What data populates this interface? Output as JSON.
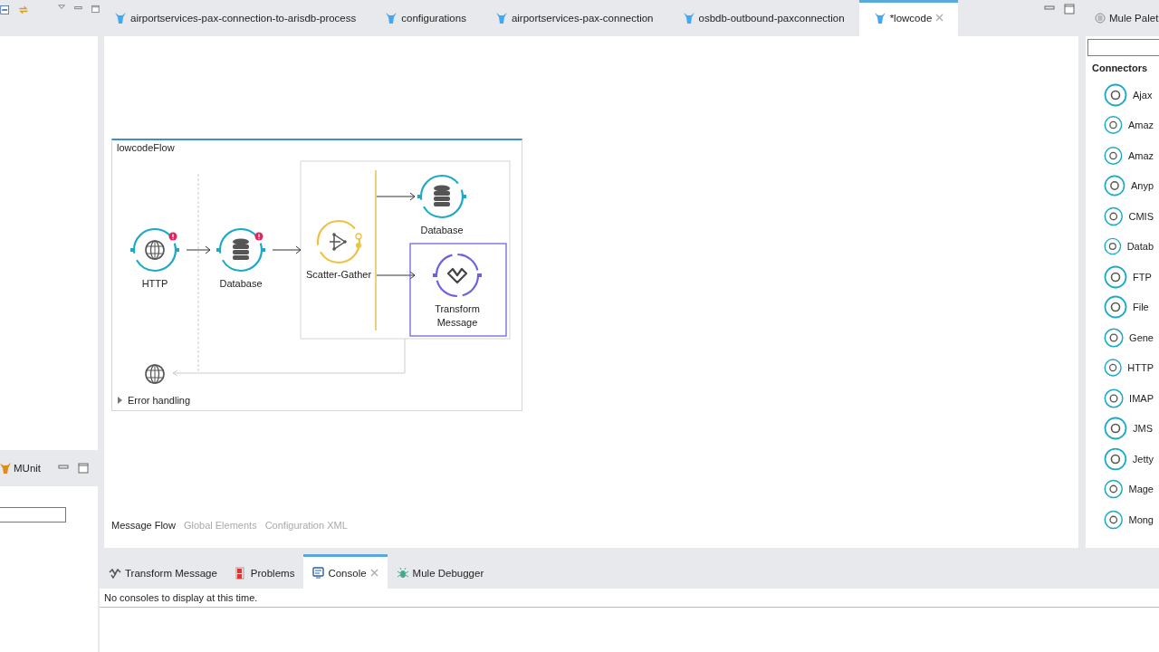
{
  "editor_tabs": [
    {
      "label": "airportservices-pax-connection-to-arisdb-process",
      "selected": false,
      "closable": false
    },
    {
      "label": "configurations",
      "selected": false,
      "closable": false
    },
    {
      "label": "airportservices-pax-connection",
      "selected": false,
      "closable": false
    },
    {
      "label": "osbdb-outbound-paxconnection",
      "selected": false,
      "closable": false
    },
    {
      "label": "*lowcode",
      "selected": true,
      "closable": true
    }
  ],
  "flow": {
    "title": "lowcodeFlow",
    "nodes": [
      {
        "kind": "http",
        "label": "HTTP",
        "error": true,
        "selected": false
      },
      {
        "kind": "database",
        "label": "Database",
        "error": true,
        "selected": false
      },
      {
        "kind": "scatter",
        "label": "Scatter-Gather",
        "error": false,
        "selected": false
      },
      {
        "kind": "database",
        "label": "Database",
        "error": false,
        "selected": false
      },
      {
        "kind": "transform",
        "label": "Transform Message",
        "error": false,
        "selected": true
      }
    ],
    "error_handling": {
      "label": "Error handling",
      "expanded": false
    }
  },
  "view_tabs": [
    {
      "label": "Message Flow",
      "selected": true
    },
    {
      "label": "Global Elements",
      "selected": false
    },
    {
      "label": "Configuration XML",
      "selected": false
    }
  ],
  "left_panel": {
    "title": "MUnit"
  },
  "palette": {
    "title": "Mule Palet",
    "section": "Connectors",
    "items": [
      {
        "label": "Ajax"
      },
      {
        "label": "Amaz"
      },
      {
        "label": "Amaz"
      },
      {
        "label": "Anyp"
      },
      {
        "label": "CMIS"
      },
      {
        "label": "Datab"
      },
      {
        "label": "FTP"
      },
      {
        "label": "File"
      },
      {
        "label": "Gene"
      },
      {
        "label": "HTTP"
      },
      {
        "label": "IMAP"
      },
      {
        "label": "JMS"
      },
      {
        "label": "Jetty"
      },
      {
        "label": "Mage"
      },
      {
        "label": "Mong"
      }
    ]
  },
  "bottom_tabs": [
    {
      "kind": "transform",
      "label": "Transform Message",
      "selected": false,
      "closable": false
    },
    {
      "kind": "problems",
      "label": "Problems",
      "selected": false,
      "closable": false
    },
    {
      "kind": "console",
      "label": "Console",
      "selected": true,
      "closable": true
    },
    {
      "kind": "debugger",
      "label": "Mule Debugger",
      "selected": false,
      "closable": false
    }
  ],
  "console": {
    "message": "No consoles to display at this time."
  }
}
